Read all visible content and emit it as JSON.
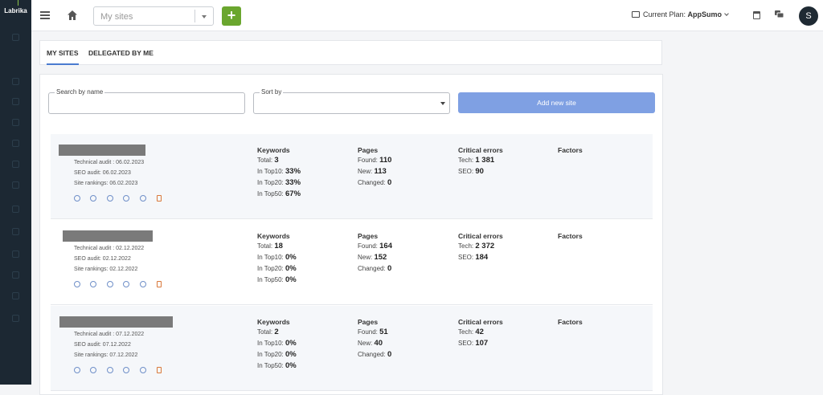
{
  "app": {
    "logo": "Labrika"
  },
  "topbar": {
    "site_select_placeholder": "My sites",
    "add_label": "+",
    "plan_label": "Current Plan:",
    "plan_name": "AppSumo",
    "avatar_initial": "S"
  },
  "tabs": [
    {
      "label": "MY SITES",
      "active": true
    },
    {
      "label": "DELEGATED BY ME",
      "active": false
    }
  ],
  "filters": {
    "search_label": "Search by name",
    "sort_label": "Sort by",
    "add_new_site": "Add new site"
  },
  "columns": {
    "keywords": "Keywords",
    "pages": "Pages",
    "critical": "Critical errors",
    "factors": "Factors"
  },
  "sites": [
    {
      "technical_audit": "Technical audit : 06.02.2023",
      "seo_audit": "SEO audit: 06.02.2023",
      "site_rankings": "Site rankings: 06.02.2023",
      "kw_total": "3",
      "kw_top10": "33%",
      "kw_top20": "33%",
      "kw_top50": "67%",
      "pg_found": "110",
      "pg_new": "113",
      "pg_changed": "0",
      "err_tech": "1 381",
      "err_seo": "90"
    },
    {
      "technical_audit": "Technical audit : 02.12.2022",
      "seo_audit": "SEO audit: 02.12.2022",
      "site_rankings": "Site rankings: 02.12.2022",
      "kw_total": "18",
      "kw_top10": "0%",
      "kw_top20": "0%",
      "kw_top50": "0%",
      "pg_found": "164",
      "pg_new": "152",
      "pg_changed": "0",
      "err_tech": "2 372",
      "err_seo": "184"
    },
    {
      "technical_audit": "Technical audit : 07.12.2022",
      "seo_audit": "SEO audit: 07.12.2022",
      "site_rankings": "Site rankings: 07.12.2022",
      "kw_total": "2",
      "kw_top10": "0%",
      "kw_top20": "0%",
      "kw_top50": "0%",
      "pg_found": "51",
      "pg_new": "40",
      "pg_changed": "0",
      "err_tech": "42",
      "err_seo": "107"
    }
  ],
  "labels": {
    "total": "Total:",
    "top10": "In Top10:",
    "top20": "In Top20:",
    "top50": "In Top50:",
    "found": "Found:",
    "new": "New:",
    "changed": "Changed:",
    "tech": "Tech:",
    "seo": "SEO:"
  }
}
